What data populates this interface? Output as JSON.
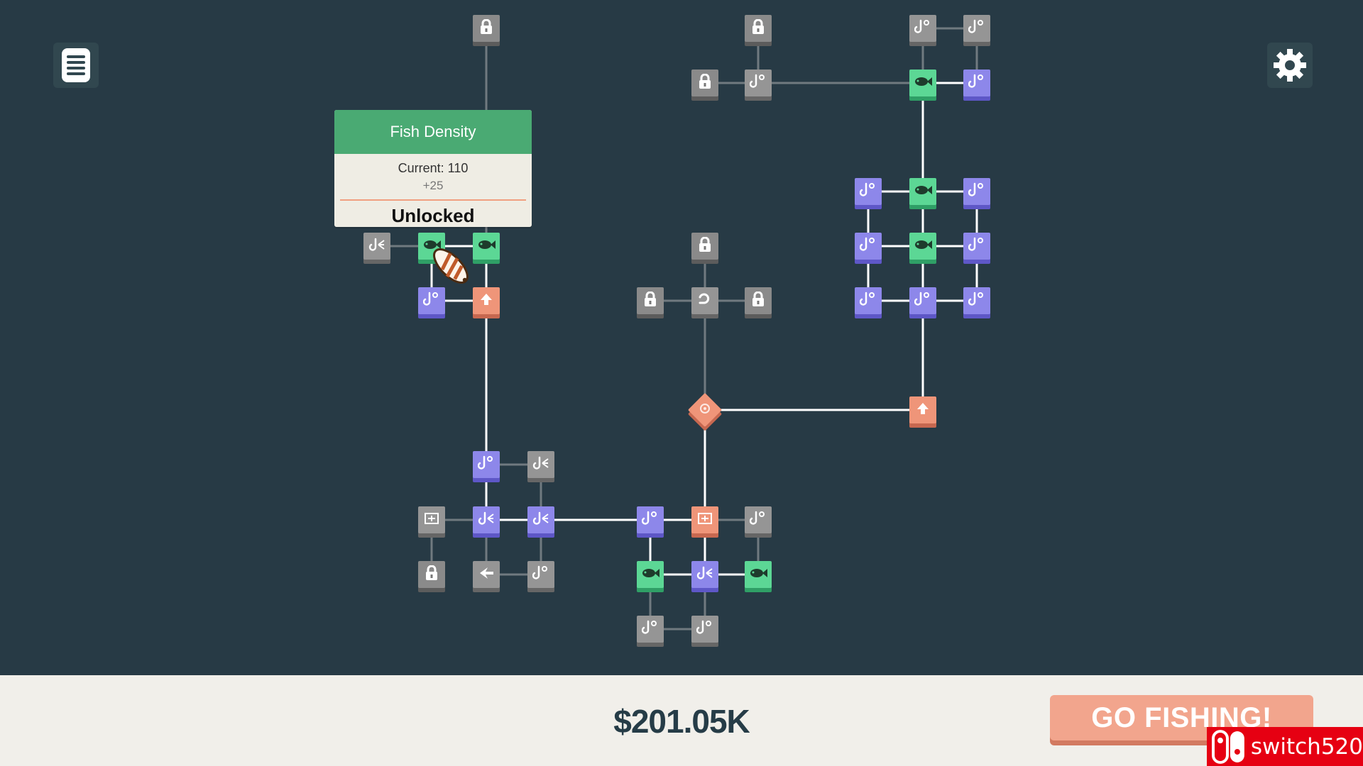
{
  "colors": {
    "background": "#273a45",
    "node_locked": "#8a8a8a",
    "node_purple": "#8d87ea",
    "node_green": "#5cd795",
    "node_salmon": "#ef9579",
    "tooltip_header": "#4aaa73",
    "go_button": "#f2a58d",
    "bottom_bar": "#f1efea"
  },
  "hud": {
    "menu_icon": "list-icon",
    "settings_icon": "gear-icon"
  },
  "tooltip": {
    "title": "Fish Density",
    "current": "Current: 110",
    "delta": "+25",
    "status": "Unlocked"
  },
  "bottom": {
    "money": "$201.05K",
    "go_button_label": "GO FISHING!"
  },
  "watermark": {
    "text": "switch520",
    "icon": "switch-logo-icon"
  },
  "skill_tree": {
    "node_types": [
      "locked",
      "gray",
      "purple",
      "green",
      "salmon",
      "diamond"
    ],
    "icon_names": [
      "lock-icon",
      "hook-icon",
      "fish-icon",
      "boost-arrow-icon",
      "crate-icon",
      "scatter-icon",
      "reel-icon",
      "center-diamond-icon"
    ]
  }
}
